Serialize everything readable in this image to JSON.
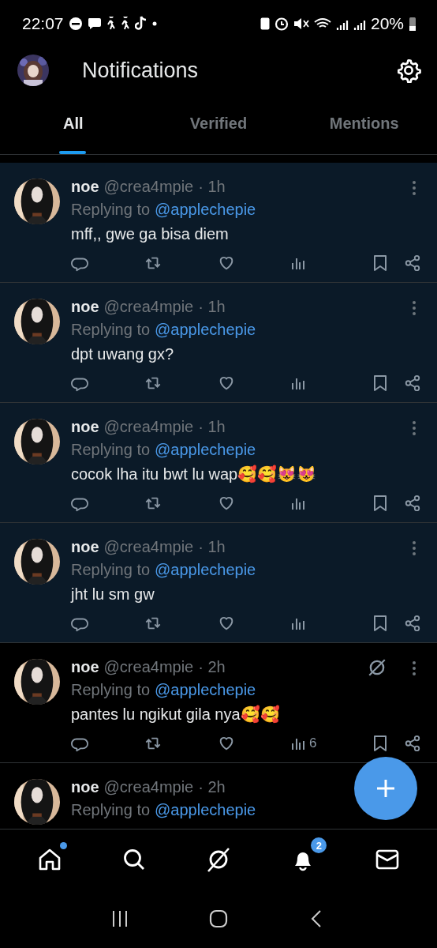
{
  "status_bar": {
    "time": "22:07",
    "battery": "20%"
  },
  "header": {
    "title": "Notifications"
  },
  "tabs": [
    {
      "label": "All",
      "selected": true
    },
    {
      "label": "Verified",
      "selected": false
    },
    {
      "label": "Mentions",
      "selected": false
    }
  ],
  "notifications": [
    {
      "name": "noe",
      "handle": "@crea4mpie",
      "time": "· 1h",
      "replying_label": "Replying to",
      "reply_to": "@applechepie",
      "text": "mff,, gwe ga bisa diem",
      "unread": true,
      "grok": false
    },
    {
      "name": "noe",
      "handle": "@crea4mpie",
      "time": "· 1h",
      "replying_label": "Replying to",
      "reply_to": "@applechepie",
      "text": "dpt uwang gx?",
      "unread": true,
      "grok": false
    },
    {
      "name": "noe",
      "handle": "@crea4mpie",
      "time": "· 1h",
      "replying_label": "Replying to",
      "reply_to": "@applechepie",
      "text": "cocok lha itu bwt lu wap🥰🥰😻😻",
      "unread": true,
      "grok": false
    },
    {
      "name": "noe",
      "handle": "@crea4mpie",
      "time": "· 1h",
      "replying_label": "Replying to",
      "reply_to": "@applechepie",
      "text": "jht lu sm gw",
      "unread": true,
      "grok": false
    },
    {
      "name": "noe",
      "handle": "@crea4mpie",
      "time": "· 2h",
      "replying_label": "Replying to",
      "reply_to": "@applechepie",
      "text": "pantes lu ngikut gila nya🥰🥰",
      "unread": false,
      "grok": true,
      "views": "6"
    },
    {
      "name": "noe",
      "handle": "@crea4mpie",
      "time": "· 2h",
      "replying_label": "Replying to",
      "reply_to": "@applechepie",
      "unread": false,
      "grok": false
    }
  ],
  "bottom_nav": {
    "home_dot": true,
    "notification_badge": "2"
  }
}
